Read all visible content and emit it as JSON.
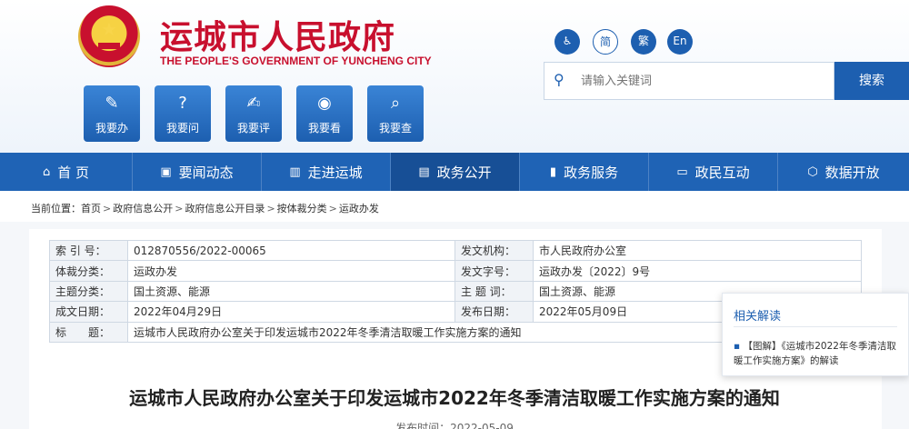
{
  "header": {
    "site_name_cn": "运城市人民政府",
    "site_name_en": "THE PEOPLE'S GOVERNMENT OF YUNCHENG CITY",
    "emblem_icon": "national-emblem-icon",
    "brand_color": "#c8102e",
    "accent_color": "#1d5fb0"
  },
  "quick_links": [
    {
      "label": "我要办",
      "icon": "edit-doc-icon"
    },
    {
      "label": "我要问",
      "icon": "question-icon"
    },
    {
      "label": "我要评",
      "icon": "pencil-square-icon"
    },
    {
      "label": "我要看",
      "icon": "eye-icon"
    },
    {
      "label": "我要查",
      "icon": "search-icon"
    }
  ],
  "toolbar": {
    "accessibility_icon": "wheelchair-icon",
    "simplified_label": "简",
    "traditional_label": "繁",
    "english_label": "En"
  },
  "search": {
    "placeholder": "请输入关键词",
    "button_label": "搜索"
  },
  "nav": {
    "items": [
      {
        "label": "首 页",
        "icon": "home-icon"
      },
      {
        "label": "要闻动态",
        "icon": "news-icon"
      },
      {
        "label": "走进运城",
        "icon": "building-icon"
      },
      {
        "label": "政务公开",
        "icon": "book-icon",
        "active": true
      },
      {
        "label": "政务服务",
        "icon": "bookmark-icon"
      },
      {
        "label": "政民互动",
        "icon": "chat-icon"
      },
      {
        "label": "数据开放",
        "icon": "cube-icon"
      }
    ]
  },
  "breadcrumb": {
    "prefix": "当前位置：",
    "items": [
      "首页",
      "政府信息公开",
      "政府信息公开目录",
      "按体裁分类",
      "运政办发"
    ],
    "separator": ">"
  },
  "info": {
    "index_label": "索 引 号：",
    "index_value": "012870556/2022-00065",
    "issuer_label": "发文机构：",
    "issuer_value": "市人民政府办公室",
    "genre_label": "体裁分类：",
    "genre_value": "运政办发",
    "docno_label": "发文字号：",
    "docno_value": "运政办发〔2022〕9号",
    "topic_label": "主题分类：",
    "topic_value": "国土资源、能源",
    "keyword_label": "主 题 词：",
    "keyword_value": "国土资源、能源",
    "created_label": "成文日期：",
    "created_value": "2022年04月29日",
    "published_label": "发布日期：",
    "published_value": "2022年05月09日",
    "title_label": "标　　题：",
    "title_value": "运城市人民政府办公室关于印发运城市2022年冬季清洁取暖工作实施方案的通知"
  },
  "related": {
    "title": "相关解读",
    "items": [
      "【图解】《运城市2022年冬季清洁取暖工作实施方案》的解读"
    ]
  },
  "document": {
    "title": "运城市人民政府办公室关于印发运城市2022年冬季清洁取暖工作实施方案的通知",
    "date_text": "发布时间：2022-05-09"
  }
}
